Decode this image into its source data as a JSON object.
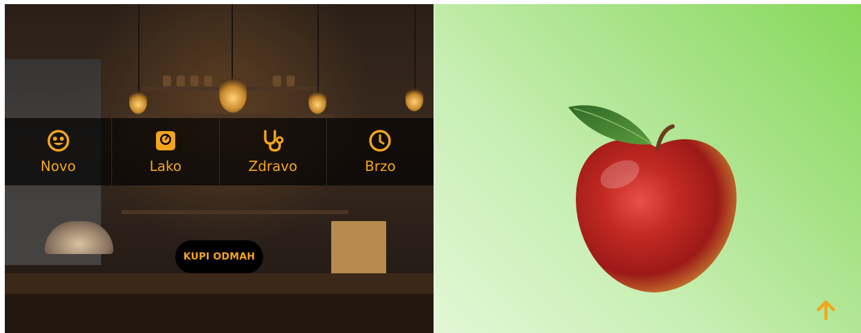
{
  "features": [
    {
      "label": "Novo",
      "icon": "smile-icon"
    },
    {
      "label": "Lako",
      "icon": "scale-icon"
    },
    {
      "label": "Zdravo",
      "icon": "stethoscope-icon"
    },
    {
      "label": "Brzo",
      "icon": "clock-icon"
    }
  ],
  "cta": {
    "label": "KUPI ODMAH"
  },
  "hero_image": {
    "icon": "apple-image"
  },
  "scroll_top": {
    "icon": "arrow-up-icon"
  },
  "colors": {
    "accent": "#f4a51c",
    "bar_bg": "#000000",
    "green": "#86d85a"
  }
}
